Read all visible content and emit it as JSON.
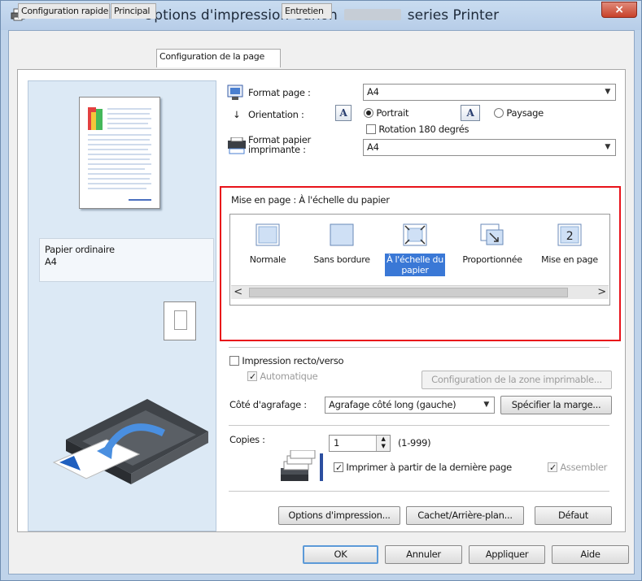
{
  "window": {
    "title_prefix": "Options d'impression Canon",
    "title_suffix": "series Printer",
    "close_label": "×"
  },
  "tabs": [
    "Configuration rapide",
    "Principal",
    "Configuration de la page",
    "Entretien"
  ],
  "preview": {
    "paper_type": "Papier ordinaire",
    "paper_size": "A4"
  },
  "page_setup": {
    "page_size_label": "Format page :",
    "page_size_value": "A4",
    "orientation_label": "Orientation :",
    "portrait_label": "Portrait",
    "landscape_label": "Paysage",
    "rotate_label": "Rotation 180 degrés",
    "printer_paper_label_1": "Format papier",
    "printer_paper_label_2": "imprimante :",
    "printer_paper_value": "A4"
  },
  "layout": {
    "label": "Mise en page : À l'échelle du papier",
    "options": [
      {
        "name": "Normale",
        "line2": ""
      },
      {
        "name": "Sans bordure",
        "line2": ""
      },
      {
        "name": "À l'échelle du",
        "line2": "papier"
      },
      {
        "name": "Proportionnée",
        "line2": ""
      },
      {
        "name": "Mise en page",
        "line2": ""
      }
    ],
    "selected_index": 2,
    "scroll_left": "<",
    "scroll_right": ">"
  },
  "duplex": {
    "label": "Impression recto/verso",
    "auto_label": "Automatique",
    "print_area_button": "Configuration de la zone imprimable..."
  },
  "staple": {
    "label": "Côté d'agrafage :",
    "value": "Agrafage côté long (gauche)",
    "margin_button": "Spécifier la marge..."
  },
  "copies": {
    "label": "Copies :",
    "value": "1",
    "range": "(1-999)",
    "last_page_label": "Imprimer à partir de la dernière page",
    "collate_label": "Assembler"
  },
  "bottom_buttons": {
    "print_options": "Options d'impression...",
    "stamp_background": "Cachet/Arrière-plan...",
    "defaults": "Défaut"
  },
  "dialog_buttons": {
    "ok": "OK",
    "cancel": "Annuler",
    "apply": "Appliquer",
    "help": "Aide"
  },
  "colors": {
    "highlight": "#e8121a",
    "selection": "#3a78d6"
  }
}
